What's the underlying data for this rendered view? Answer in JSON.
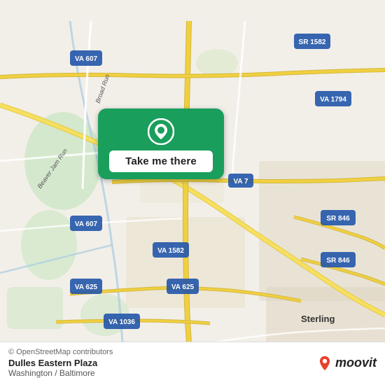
{
  "map": {
    "bg_color": "#f2efe9",
    "attribution": "© OpenStreetMap contributors",
    "center_lat": 39.0,
    "center_lng": -77.4
  },
  "button": {
    "label": "Take me there",
    "bg_color": "#1a9e5c"
  },
  "bottom_bar": {
    "osm_credit": "© OpenStreetMap contributors",
    "location_name": "Dulles Eastern Plaza",
    "location_city": "Washington / Baltimore",
    "moovit_label": "moovit"
  },
  "road_labels": [
    {
      "id": "va607_top",
      "text": "VA 607"
    },
    {
      "id": "sr1582",
      "text": "SR 1582"
    },
    {
      "id": "va1794",
      "text": "VA 1794"
    },
    {
      "id": "va7",
      "text": "VA 7"
    },
    {
      "id": "va607_bot",
      "text": "VA 607"
    },
    {
      "id": "va1582",
      "text": "VA 1582"
    },
    {
      "id": "sr846_top",
      "text": "SR 846"
    },
    {
      "id": "sr846_bot",
      "text": "SR 846"
    },
    {
      "id": "va625_bot",
      "text": "VA 625"
    },
    {
      "id": "va625_left",
      "text": "VA 625"
    },
    {
      "id": "va1036",
      "text": "VA 1036"
    },
    {
      "id": "sterling",
      "text": "Sterling"
    },
    {
      "id": "broadrun",
      "text": "Broad Run"
    },
    {
      "id": "beaverjamrun",
      "text": "Beaver Jam Run"
    }
  ]
}
